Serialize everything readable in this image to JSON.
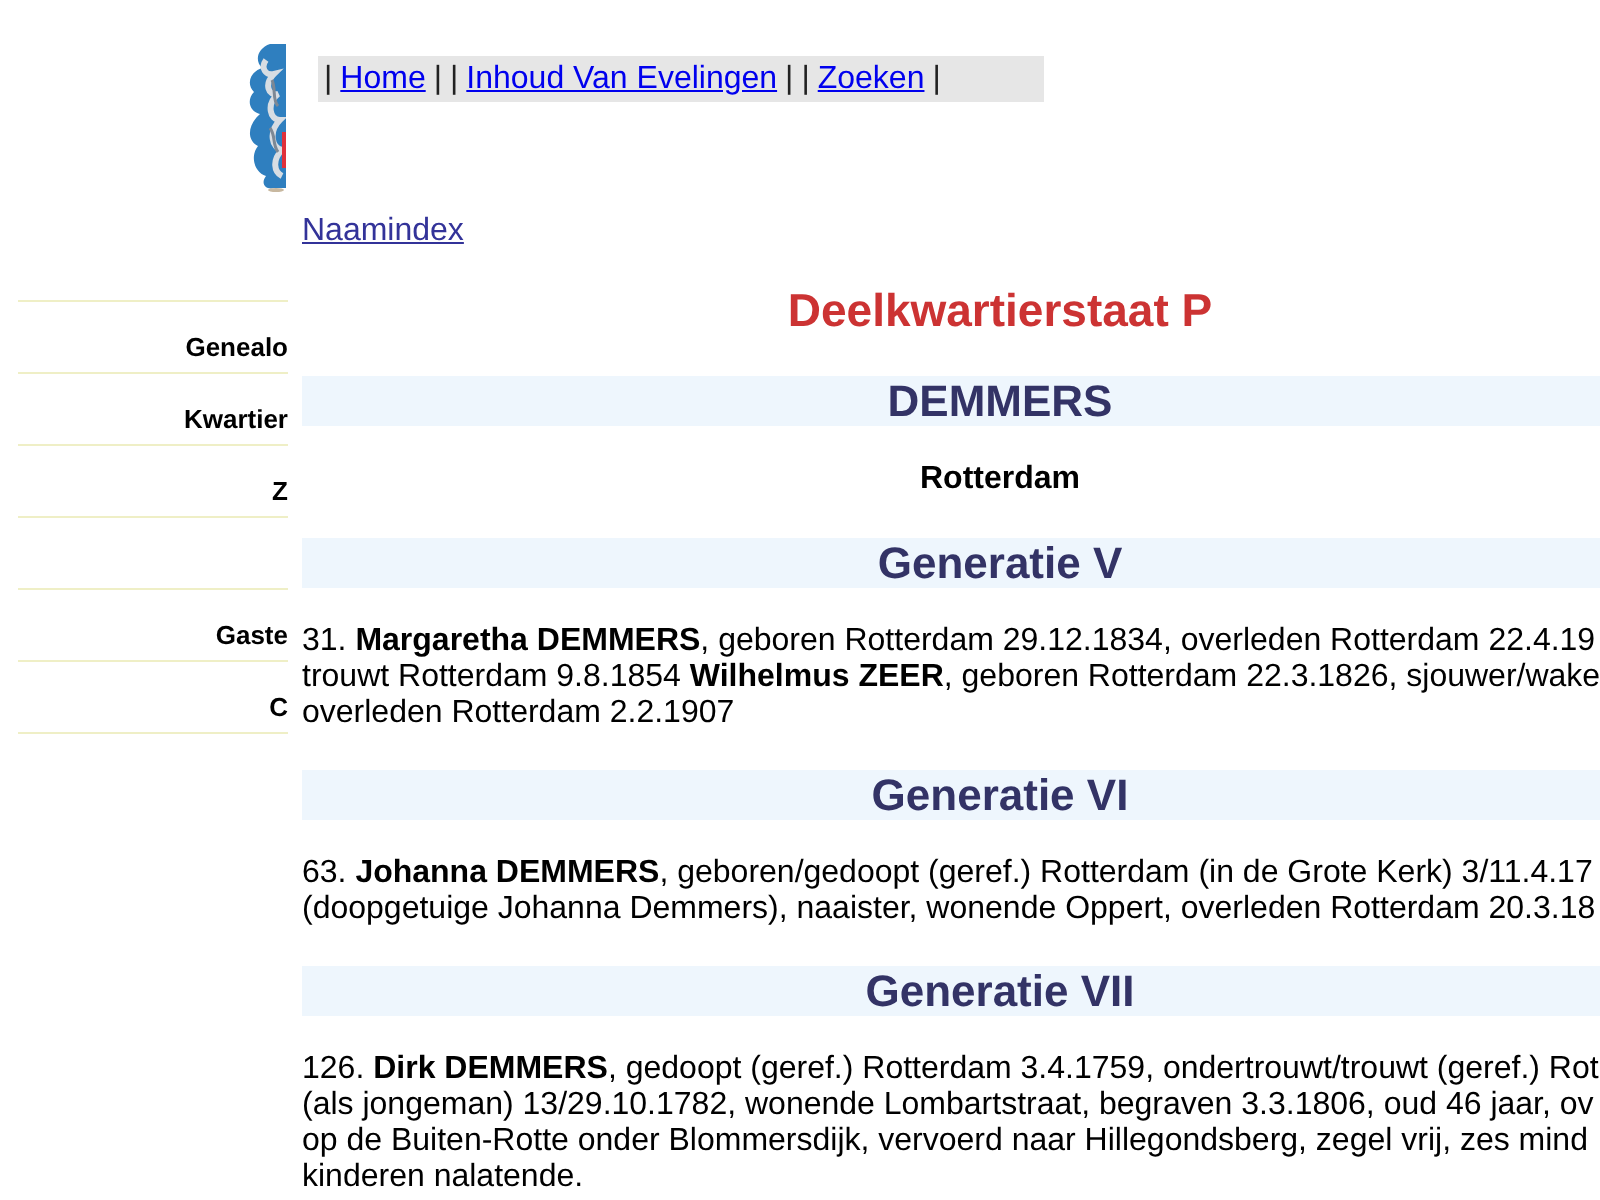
{
  "sidebar": {
    "items": [
      {
        "kind": "link",
        "label": "Genealo"
      },
      {
        "kind": "link",
        "label": "Kwartier"
      },
      {
        "kind": "link",
        "label": "Z"
      },
      {
        "kind": "blank"
      },
      {
        "kind": "link",
        "label": "Gaste"
      },
      {
        "kind": "link",
        "label": "C"
      }
    ]
  },
  "nav": {
    "items": [
      {
        "before": "|",
        "label": "Home",
        "after": "|"
      },
      {
        "before": "|",
        "label": "Inhoud Van Evelingen",
        "after": "|"
      },
      {
        "before": "|",
        "label": "Zoeken",
        "after": "|"
      }
    ]
  },
  "index_link": "Naamindex",
  "title": "Deelkwartierstaat P",
  "family": {
    "name": "DEMMERS",
    "place": "Rotterdam"
  },
  "generations": [
    {
      "heading": "Generatie V",
      "entries": [
        {
          "lines": [
            "31. **Margaretha DEMMERS**, geboren Rotterdam 29.12.1834, overleden Rotterdam 22.4.19",
            "trouwt Rotterdam 9.8.1854 **Wilhelmus ZEER**, geboren Rotterdam 22.3.1826, sjouwer/wake",
            "overleden Rotterdam 2.2.1907"
          ]
        }
      ]
    },
    {
      "heading": "Generatie VI",
      "entries": [
        {
          "lines": [
            "63. **Johanna DEMMERS**, geboren/gedoopt (geref.) Rotterdam (in de Grote Kerk) 3/11.4.17",
            "(doopgetuige Johanna Demmers), naaister, wonende Oppert, overleden Rotterdam 20.3.18"
          ]
        }
      ]
    },
    {
      "heading": "Generatie VII",
      "entries": [
        {
          "lines": [
            "126. **Dirk DEMMERS**, gedoopt (geref.) Rotterdam 3.4.1759, ondertrouwt/trouwt (geref.) Rot",
            "(als jongeman) 13/29.10.1782, wonende Lombartstraat, begraven 3.3.1806, oud 46 jaar, ov",
            "op de Buiten-Rotte onder Blommersdijk, vervoerd naar Hillegondsberg, zegel vrij, zes mind",
            "kinderen nalatende."
          ]
        }
      ]
    }
  ]
}
